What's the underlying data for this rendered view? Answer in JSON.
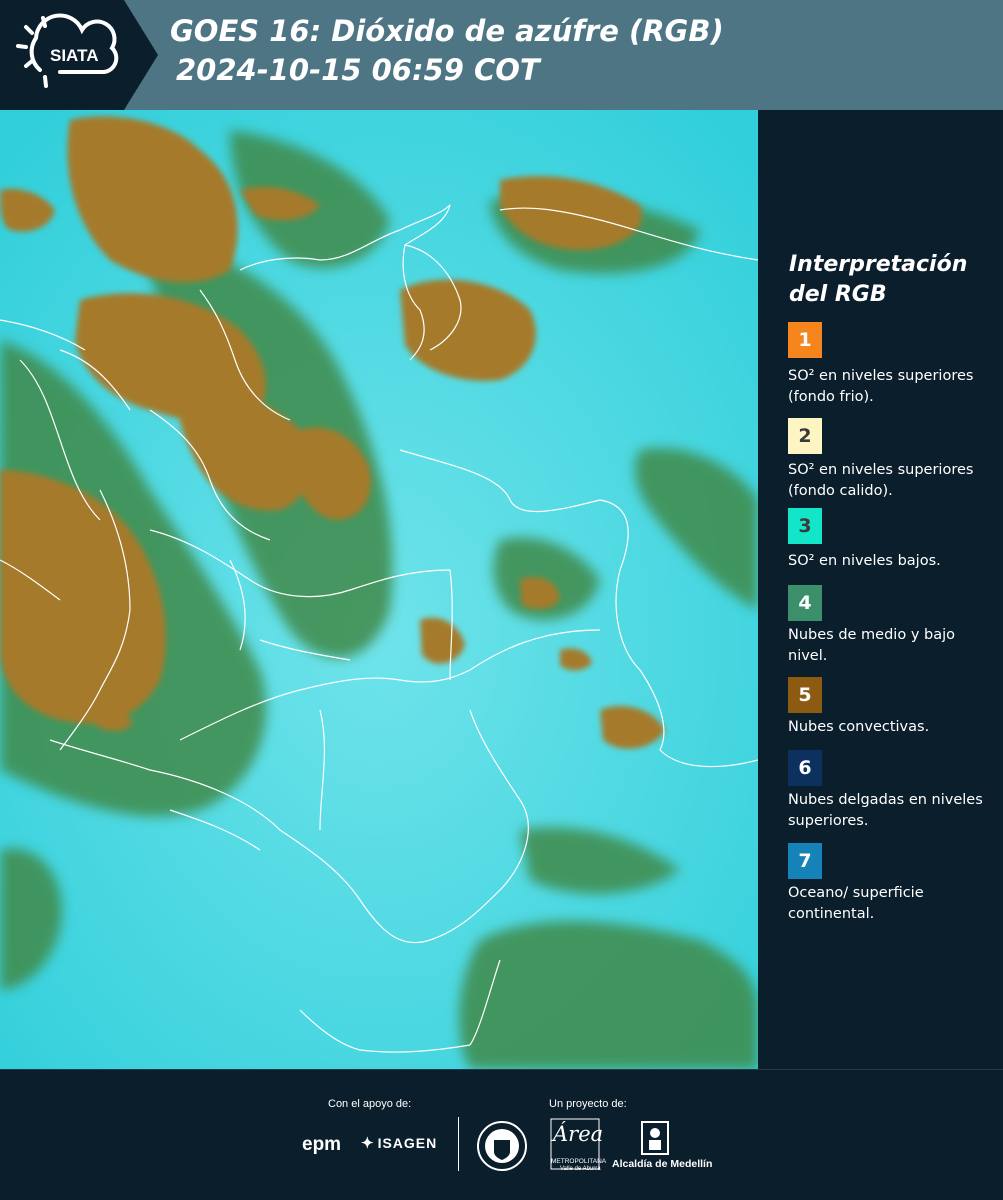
{
  "header": {
    "logo_text": "SIATA",
    "title_line1": "GOES 16: Dióxido de azúfre (RGB)",
    "title_line2": "2024-10-15 06:59 COT"
  },
  "map": {
    "ocean_color": "#3dd4dd",
    "convective_cloud_color": "#a57a2c",
    "mid_low_cloud_color": "#3f8a4a",
    "border_color": "#ffffff"
  },
  "legend": {
    "title": "Interpretación del RGB",
    "items": [
      {
        "number": "1",
        "color": "#f7851e",
        "text": "SO² en niveles superiores (fondo frio)."
      },
      {
        "number": "2",
        "color": "#fdf6c3",
        "text": "SO² en niveles superiores (fondo calido)."
      },
      {
        "number": "3",
        "color": "#13e6c8",
        "text": "SO² en niveles bajos."
      },
      {
        "number": "4",
        "color": "#3b8f6b",
        "text": "Nubes de medio y bajo nivel."
      },
      {
        "number": "5",
        "color": "#8c5b11",
        "text": "Nubes convectivas."
      },
      {
        "number": "6",
        "color": "#0d315f",
        "text": "Nubes delgadas en niveles superiores."
      },
      {
        "number": "7",
        "color": "#1683b8",
        "text": "Oceano/ superficie continental."
      }
    ]
  },
  "footer": {
    "support_caption": "Con el apoyo de:",
    "project_caption": "Un proyecto de:",
    "epm": "epm",
    "isagen": "ISAGEN",
    "area_word": "Área",
    "area_sub1": "METROPOLITANA",
    "area_sub2": "Valle de Aburrá",
    "alcaldia": "Alcaldía de Medellín"
  }
}
